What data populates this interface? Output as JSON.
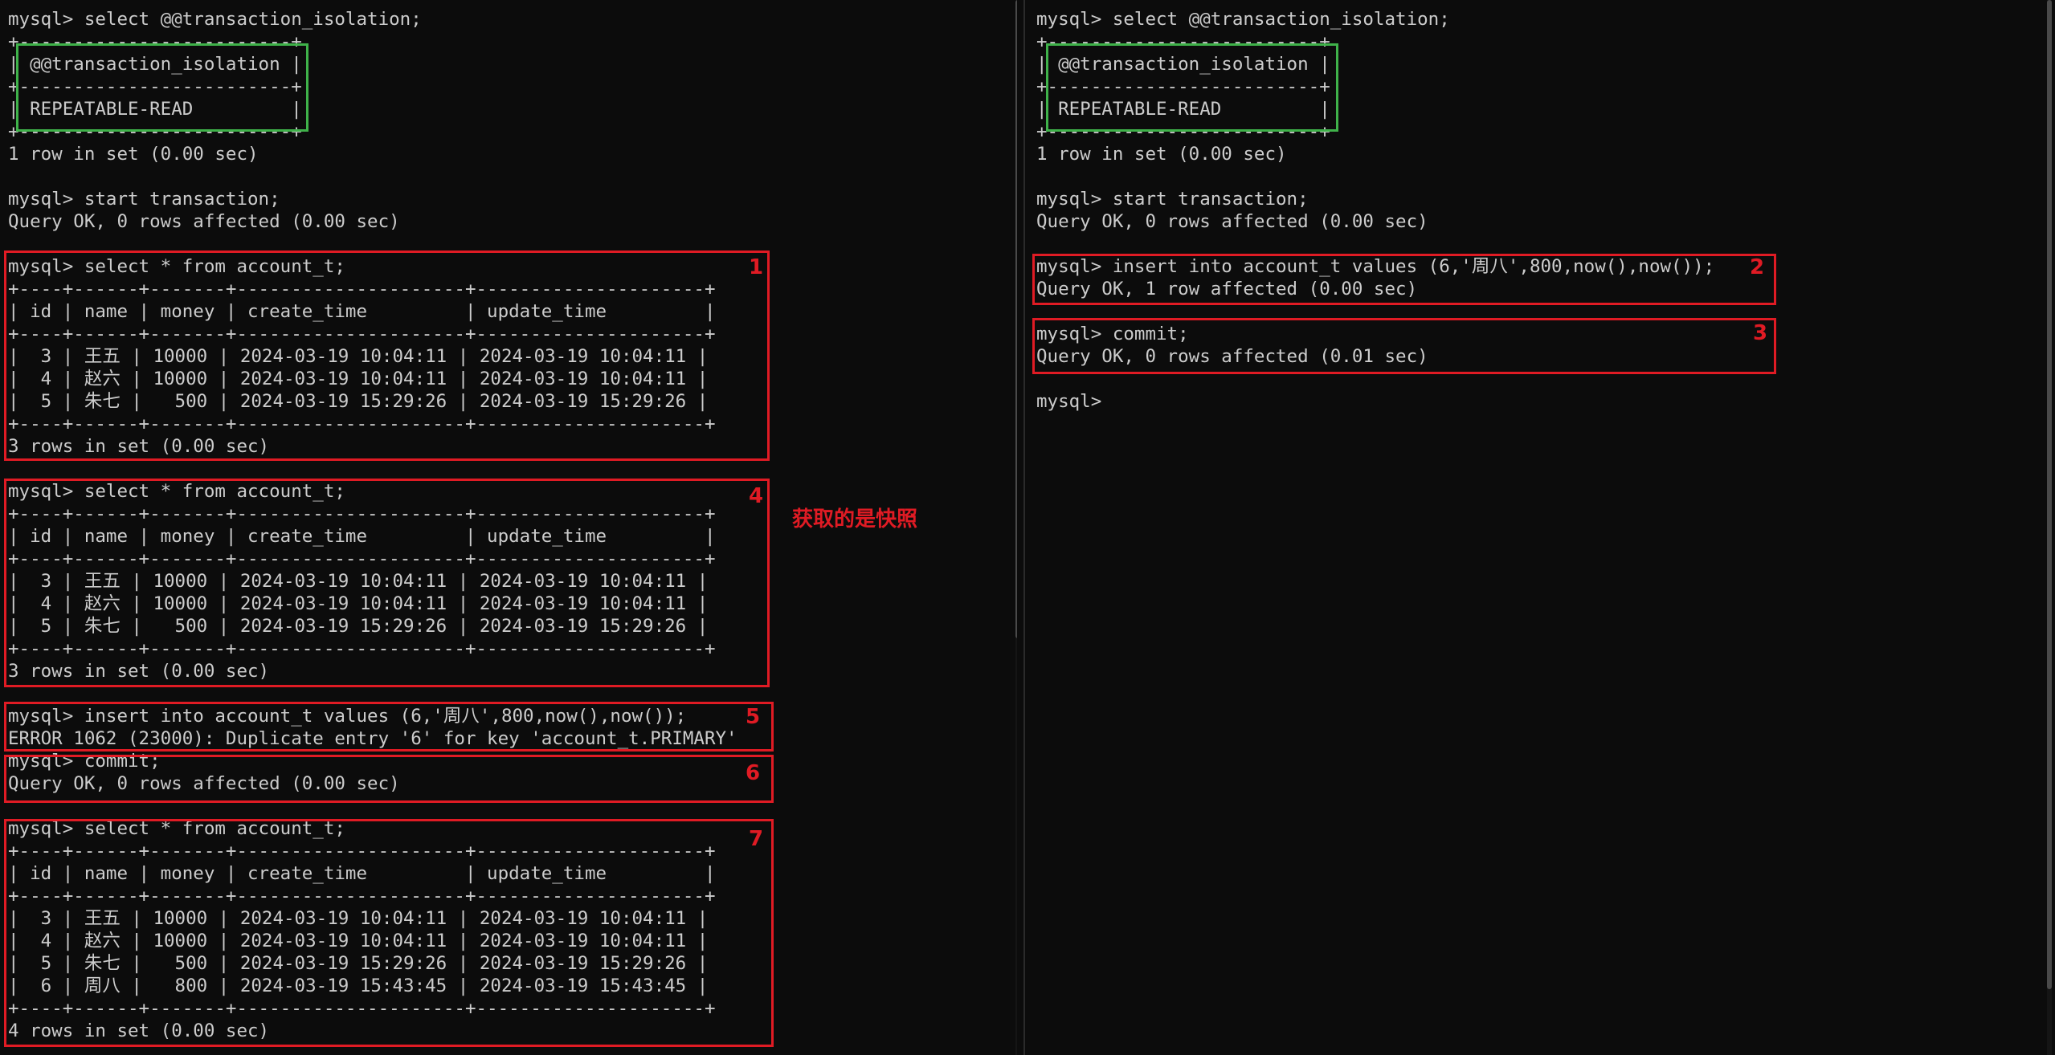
{
  "left": {
    "lines": [
      "mysql> select @@transaction_isolation;",
      "+-------------------------+",
      "| @@transaction_isolation |",
      "+-------------------------+",
      "| REPEATABLE-READ         |",
      "+-------------------------+",
      "1 row in set (0.00 sec)",
      "",
      "mysql> start transaction;",
      "Query OK, 0 rows affected (0.00 sec)",
      "",
      "mysql> select * from account_t;",
      "+----+------+-------+---------------------+---------------------+",
      "| id | name | money | create_time         | update_time         |",
      "+----+------+-------+---------------------+---------------------+",
      "|  3 | 王五 | 10000 | 2024-03-19 10:04:11 | 2024-03-19 10:04:11 |",
      "|  4 | 赵六 | 10000 | 2024-03-19 10:04:11 | 2024-03-19 10:04:11 |",
      "|  5 | 朱七 |   500 | 2024-03-19 15:29:26 | 2024-03-19 15:29:26 |",
      "+----+------+-------+---------------------+---------------------+",
      "3 rows in set (0.00 sec)",
      "",
      "mysql> select * from account_t;",
      "+----+------+-------+---------------------+---------------------+",
      "| id | name | money | create_time         | update_time         |",
      "+----+------+-------+---------------------+---------------------+",
      "|  3 | 王五 | 10000 | 2024-03-19 10:04:11 | 2024-03-19 10:04:11 |",
      "|  4 | 赵六 | 10000 | 2024-03-19 10:04:11 | 2024-03-19 10:04:11 |",
      "|  5 | 朱七 |   500 | 2024-03-19 15:29:26 | 2024-03-19 15:29:26 |",
      "+----+------+-------+---------------------+---------------------+",
      "3 rows in set (0.00 sec)",
      "",
      "mysql> insert into account_t values (6,'周八',800,now(),now());",
      "ERROR 1062 (23000): Duplicate entry '6' for key 'account_t.PRIMARY'",
      "mysql> commit;",
      "Query OK, 0 rows affected (0.00 sec)",
      "",
      "mysql> select * from account_t;",
      "+----+------+-------+---------------------+---------------------+",
      "| id | name | money | create_time         | update_time         |",
      "+----+------+-------+---------------------+---------------------+",
      "|  3 | 王五 | 10000 | 2024-03-19 10:04:11 | 2024-03-19 10:04:11 |",
      "|  4 | 赵六 | 10000 | 2024-03-19 10:04:11 | 2024-03-19 10:04:11 |",
      "|  5 | 朱七 |   500 | 2024-03-19 15:29:26 | 2024-03-19 15:29:26 |",
      "|  6 | 周八 |   800 | 2024-03-19 15:43:45 | 2024-03-19 15:43:45 |",
      "+----+------+-------+---------------------+---------------------+",
      "4 rows in set (0.00 sec)"
    ],
    "step_labels": [
      "1",
      "4",
      "5",
      "6",
      "7"
    ],
    "note": "获取的是快照"
  },
  "right": {
    "lines": [
      "mysql> select @@transaction_isolation;",
      "+-------------------------+",
      "| @@transaction_isolation |",
      "+-------------------------+",
      "| REPEATABLE-READ         |",
      "+-------------------------+",
      "1 row in set (0.00 sec)",
      "",
      "mysql> start transaction;",
      "Query OK, 0 rows affected (0.00 sec)",
      "",
      "mysql> insert into account_t values (6,'周八',800,now(),now());",
      "Query OK, 1 row affected (0.00 sec)",
      "",
      "mysql> commit;",
      "Query OK, 0 rows affected (0.01 sec)",
      "",
      "mysql>"
    ],
    "step_labels": [
      "2",
      "3"
    ]
  },
  "colors": {
    "background": "#0c0c0c",
    "text": "#cccccc",
    "highlight_red": "#e01b24",
    "highlight_green": "#3fb24a"
  }
}
